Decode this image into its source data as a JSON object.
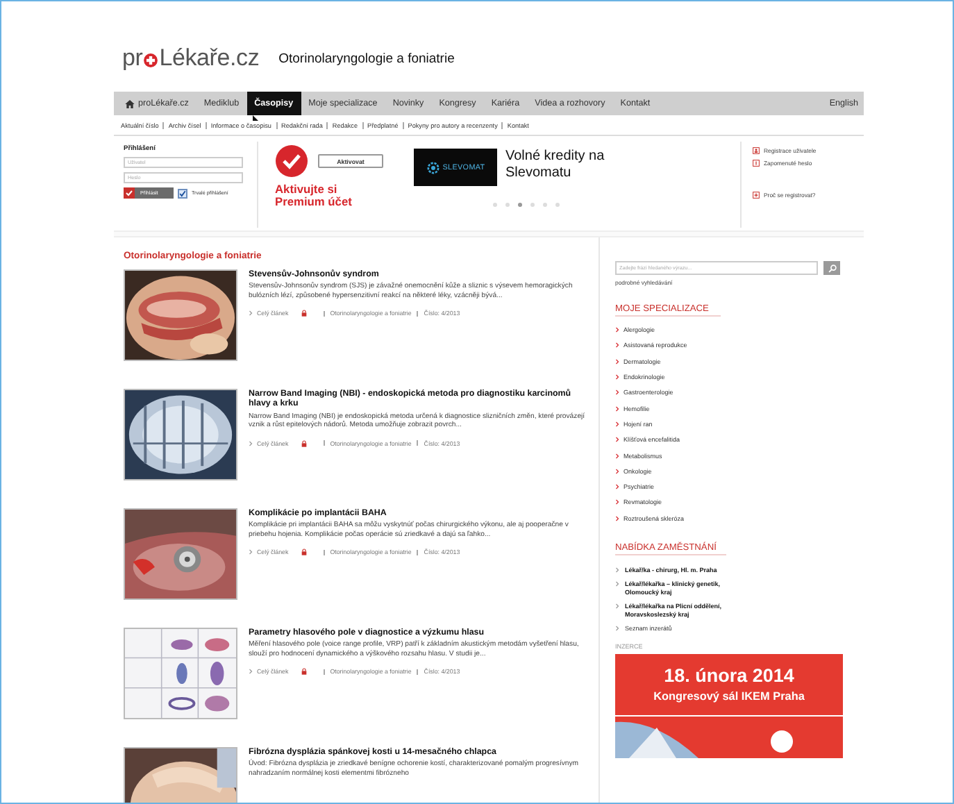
{
  "logo": {
    "before": "pr",
    "after": "Lékaře.cz"
  },
  "section_title": "Otorinolaryngologie a foniatrie",
  "nav": [
    {
      "label": "proLékaře.cz",
      "kind": "home",
      "selected": false
    },
    {
      "label": "Mediklub",
      "kind": "link",
      "selected": false
    },
    {
      "label": "Časopisy",
      "kind": "link",
      "selected": true
    },
    {
      "label": "Moje specializace",
      "kind": "link",
      "selected": false
    },
    {
      "label": "Novinky",
      "kind": "link",
      "selected": false
    },
    {
      "label": "Kongresy",
      "kind": "link",
      "selected": false
    },
    {
      "label": "Kariéra",
      "kind": "link",
      "selected": false
    },
    {
      "label": "Videa a rozhovory",
      "kind": "link",
      "selected": false
    },
    {
      "label": "Kontakt",
      "kind": "link",
      "selected": false
    }
  ],
  "language": "English",
  "subnav": [
    "Aktuální číslo",
    "Archiv čísel",
    "Informace o časopisu",
    "Redakční rada",
    "Redakce",
    "Předplatné",
    "Pokyny pro autory a recenzenty",
    "Kontakt"
  ],
  "login": {
    "title": "Přihlášení",
    "user_placeholder": "Uživatel",
    "password_placeholder": "Heslo",
    "button": "Přihlásit",
    "remember": {
      "label": "Trvalé přihlášení",
      "checked": true
    }
  },
  "premium": {
    "button": "Aktivovat",
    "text": "Aktivujte si Premium účet"
  },
  "promo": {
    "brand": "SLEVOMAT",
    "text": "Volné kredity na Slevomatu",
    "dots": [
      {
        "selected": false
      },
      {
        "selected": false
      },
      {
        "selected": true
      },
      {
        "selected": false
      },
      {
        "selected": false
      },
      {
        "selected": false
      }
    ]
  },
  "account_links": [
    {
      "label": "Registrace uživatele",
      "kind": "user"
    },
    {
      "label": "Zapomenuté heslo",
      "kind": "info"
    },
    {
      "label": "Proč se registrovat?",
      "kind": "plus"
    }
  ],
  "main": {
    "heading": "Otorinolaryngologie a foniatrie",
    "articles": [
      {
        "title": "Stevensův-Johnsonův syndrom",
        "summary": "Stevensův-Johnsonův syndrom (SJS) je závažné onemocnění kůže a sliznic s výsevem hemoragických bulózních lézí, způsobené hypersenzitivní reakcí na některé léky, vzácněji bývá...",
        "link": "Celý článek",
        "journal": "Otorinolaryngologie a foniatrie",
        "issue": "Číslo: 4/2013"
      },
      {
        "title": "Narrow Band Imaging (NBI) - endoskopická metoda pro diagnostiku karcinomů hlavy a krku",
        "summary": "Narrow Band Imaging (NBI) je endoskopická metoda určená k diagnostice slizničních změn, které provázejí vznik a růst epitelových nádorů. Metoda umožňuje zobrazit povrch...",
        "link": "Celý článek",
        "journal": "Otorinolaryngologie a foniatrie",
        "issue": "Číslo: 4/2013"
      },
      {
        "title": "Komplikácie po implantácii BAHA",
        "summary": "Komplikácie pri implantácii BAHA sa môžu vyskytnúť počas chirurgického výkonu, ale aj pooperačne v priebehu hojenia. Komplikácie počas operácie sú zriedkavé a dajú sa ľahko...",
        "link": "Celý článek",
        "journal": "Otorinolaryngologie a foniatrie",
        "issue": "Číslo: 4/2013"
      },
      {
        "title": "Parametry hlasového pole v diagnostice a výzkumu hlasu",
        "summary": "Měření hlasového pole (voice range profile, VRP) patří k základním akustickým metodám vyšetření hlasu, slouží pro hodnocení dynamického a výškového rozsahu hlasu. V studii je...",
        "link": "Celý článek",
        "journal": "Otorinolaryngologie a foniatrie",
        "issue": "Číslo: 4/2013"
      },
      {
        "title": "Fibrózna dysplázia spánkovej kosti u 14-mesačného chlapca",
        "summary": "Úvod: Fibrózna dysplázia je zriedkavé benígne ochorenie kostí, charakterizované pomalým progresívnym nahradzaním normálnej kosti elementmi fibrózneho"
      }
    ]
  },
  "sidebar": {
    "search_placeholder": "Zadejte frázi hledaného výrazu...",
    "advanced_search": "podrobné vyhledávání",
    "specializations_title": "MOJE SPECIALIZACE",
    "specializations": [
      "Alergologie",
      "Asistovaná reprodukce",
      "Dermatologie",
      "Endokrinologie",
      "Gastroenterologie",
      "Hemofilie",
      "Hojení ran",
      "Klíšťová encefalitida",
      "Metabolismus",
      "Onkologie",
      "Psychiatrie",
      "Revmatologie",
      "Roztroušená skleróza"
    ],
    "jobs_title": "NABÍDKA ZAMĚSTNÁNÍ",
    "jobs": [
      {
        "label": "Lékař/ka - chirurg, Hl. m. Praha",
        "kind": "job"
      },
      {
        "label": "Lékař/lékařka – klinický genetik, Olomoucký kraj",
        "kind": "job"
      },
      {
        "label": "Lékař/lékařka na Plicní oddělení, Moravskoslezský kraj",
        "kind": "job"
      },
      {
        "label": "Seznam inzerátů",
        "kind": "link"
      }
    ],
    "ad_label": "INZERCE",
    "ad": {
      "date": "18. února 2014",
      "place": "Kongresový sál IKEM Praha"
    }
  }
}
